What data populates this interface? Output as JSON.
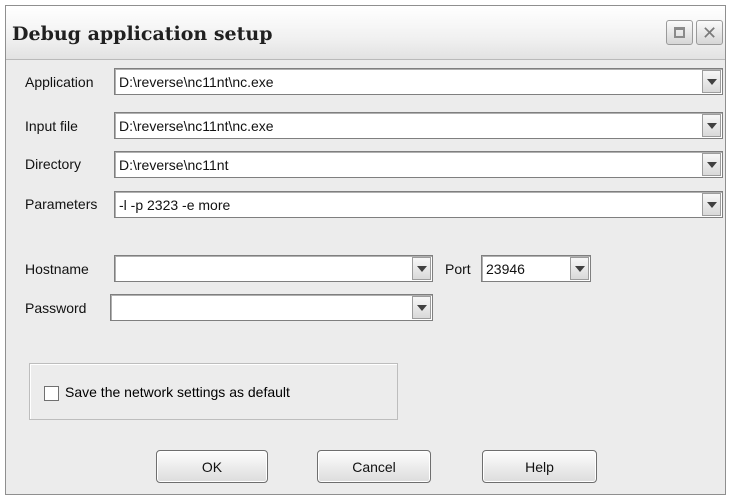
{
  "window": {
    "title": "Debug application setup",
    "maximize_icon": "maximize-icon",
    "close_icon": "close-icon"
  },
  "fields": {
    "application": {
      "label": "Application",
      "value": "D:\\reverse\\nc11nt\\nc.exe"
    },
    "input_file": {
      "label": "Input file",
      "value": "D:\\reverse\\nc11nt\\nc.exe"
    },
    "directory": {
      "label": "Directory",
      "value": "D:\\reverse\\nc11nt"
    },
    "parameters": {
      "label": "Parameters",
      "value": "-l -p 2323 -e more"
    }
  },
  "network": {
    "hostname": {
      "label": "Hostname",
      "value": ""
    },
    "port": {
      "label": "Port",
      "value": "23946"
    },
    "password": {
      "label": "Password",
      "value": ""
    },
    "save_default": {
      "label": "Save the network settings as default",
      "checked": false
    }
  },
  "buttons": {
    "ok": "OK",
    "cancel": "Cancel",
    "help": "Help"
  }
}
